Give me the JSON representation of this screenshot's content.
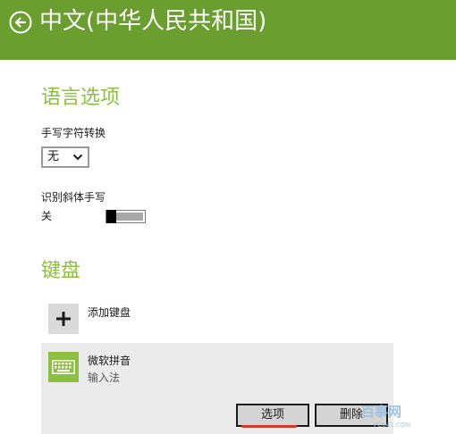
{
  "header": {
    "title": "中文(中华人民共和国)",
    "background_color": "#6a9e2e"
  },
  "language_options": {
    "title": "语言选项",
    "handwriting_conversion": {
      "label": "手写字符转换",
      "selected": "无"
    },
    "italic_handwriting": {
      "label": "识别斜体手写",
      "state_text": "关",
      "on": false
    }
  },
  "keyboards": {
    "title": "键盘",
    "add_label": "添加键盘",
    "items": [
      {
        "name": "微软拼音",
        "subtitle": "输入法",
        "icon": "keyboard-icon",
        "options_label": "选项",
        "remove_label": "删除"
      }
    ]
  },
  "watermark": {
    "text": "百事网",
    "sub": "PC841.COM"
  },
  "colors": {
    "accent": "#8cbf3f",
    "header": "#6a9e2e",
    "panel": "#ebebeb"
  }
}
